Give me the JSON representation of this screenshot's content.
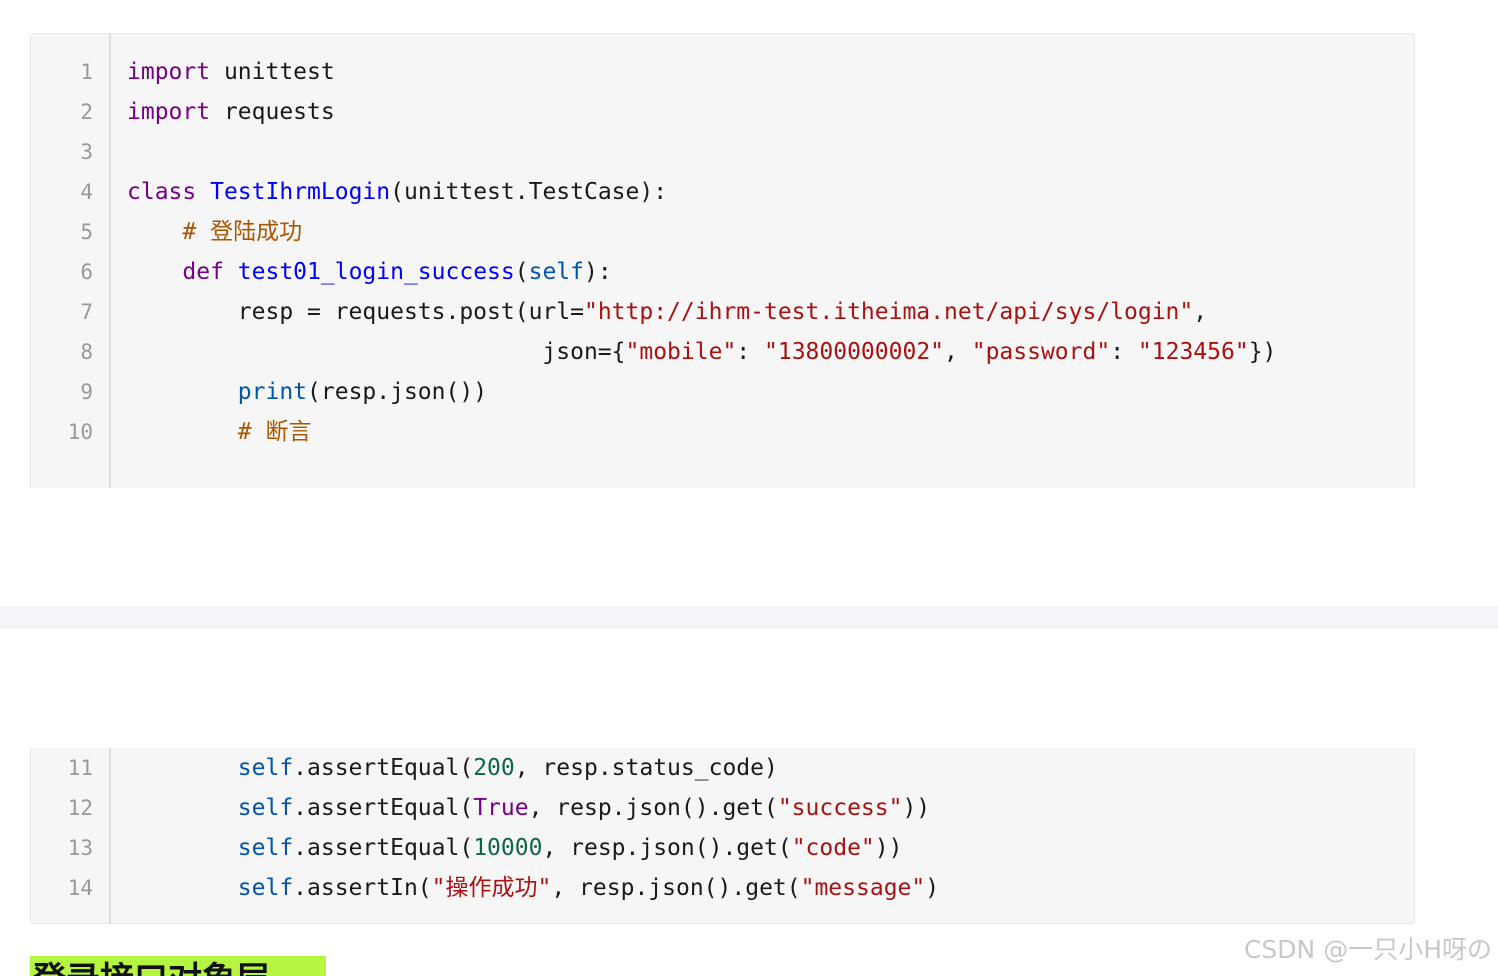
{
  "code_block": {
    "lines": [
      {
        "num": "1"
      },
      {
        "num": "2"
      },
      {
        "num": "3"
      },
      {
        "num": "4"
      },
      {
        "num": "5"
      },
      {
        "num": "6"
      },
      {
        "num": "7"
      },
      {
        "num": "8"
      },
      {
        "num": "9"
      },
      {
        "num": "10"
      },
      {
        "num": "11"
      },
      {
        "num": "12"
      },
      {
        "num": "13"
      },
      {
        "num": "14"
      }
    ],
    "tokens": {
      "import": "import",
      "unittest": " unittest",
      "requests": " requests",
      "class": "class",
      "class_name": "TestIhrmLogin",
      "class_base": "(unittest.TestCase):",
      "comment_login": "# 登陆成功",
      "def": "def",
      "func_name": "test01_login_success",
      "paren_open": "(",
      "self": "self",
      "paren_close": "):",
      "resp_assign": "resp = requests.post(url=",
      "url": "\"http://ihrm-test.itheima.net/api/sys/login\"",
      "comma": ",",
      "json_open": "json={",
      "key_mobile": "\"mobile\"",
      "colon_space": ": ",
      "val_mobile": "\"13800000002\"",
      "comma_space": ", ",
      "key_password": "\"password\"",
      "val_password": "\"123456\"",
      "json_close": "})",
      "print": "print",
      "print_args": "(resp.json())",
      "comment_assert": "# 断言",
      "assert_equal": ".assertEqual(",
      "num_200": "200",
      "status_code_rest": ", resp.status_code)",
      "true_val": "True",
      "json_get_rest": ", resp.json().get(",
      "str_success": "\"success\"",
      "close_double": "))",
      "num_10000": "10000",
      "str_code": "\"code\"",
      "assert_in": ".assertIn(",
      "str_op_success": "\"操作成功\"",
      "str_message": "\"message\"",
      "close_single": ")"
    }
  },
  "heading": {
    "text": "登录接口对象层"
  },
  "watermark": {
    "text": "CSDN @一只小H呀の"
  },
  "colors": {
    "keyword": "#770088",
    "definition": "#0000ff",
    "string": "#aa1111",
    "number": "#116644",
    "comment": "#aa5500",
    "builtin": "#0055aa",
    "heading_highlight": "#b5f542"
  }
}
